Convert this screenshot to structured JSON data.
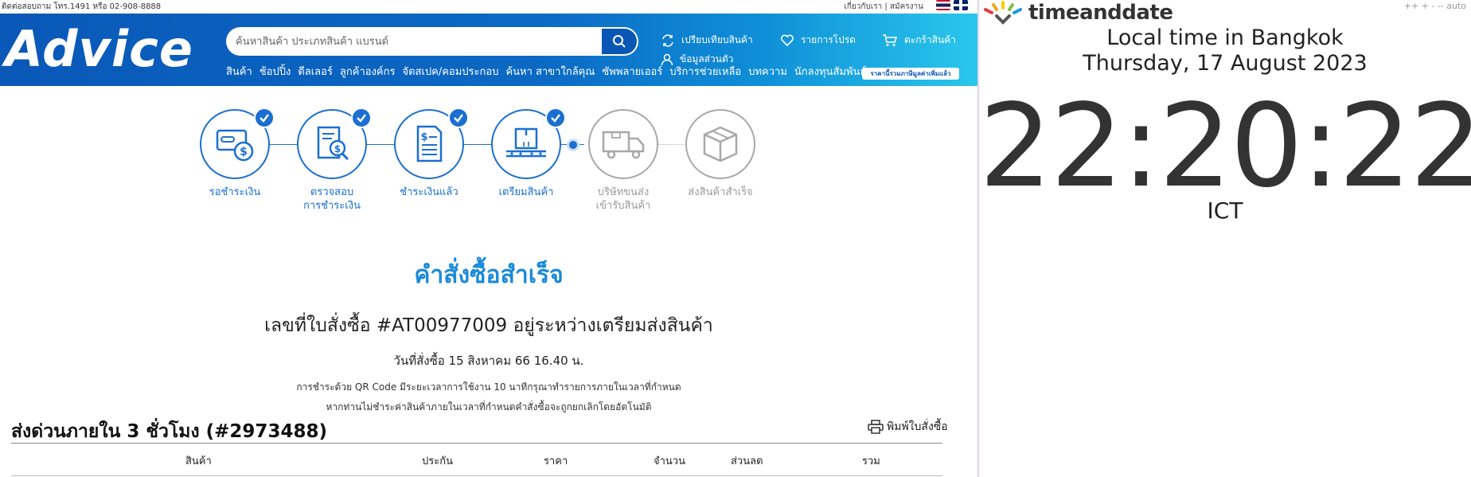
{
  "topbar": {
    "contact": "ติดต่อสอบถาม โทร.1491 หรือ 02-908-8888",
    "links": "เกี่ยวกับเรา | สมัครงาน"
  },
  "header": {
    "logo": "Advice",
    "search_placeholder": "ค้นหาสินค้า ประเภทสินค้า แบรนด์",
    "compare": "เปรียบเทียบสินค้า",
    "wishlist": "รายการโปรด",
    "cart": "ตะกร้าสินค้า",
    "profile": "ข้อมูลส่วนตัว",
    "menu": [
      "สินค้า",
      "ช้อปปิ้ง",
      "ดีลเลอร์",
      "ลูกค้าองค์กร",
      "จัดสเปค/คอมประกอบ",
      "ค้นหา สาขาใกล้คุณ",
      "ซัพพลายเออร์",
      "บริการช่วยเหลือ",
      "บทความ",
      "นักลงทุนสัมพันธ์"
    ],
    "price_badge": "ราคานี้รวมภาษีมูลค่าเพิ่มแล้ว"
  },
  "steps": [
    {
      "label1": "รอชำระเงิน",
      "label2": "",
      "done": true
    },
    {
      "label1": "ตรวจสอบ",
      "label2": "การชำระเงิน",
      "done": true
    },
    {
      "label1": "ชำระเงินแล้ว",
      "label2": "",
      "done": true
    },
    {
      "label1": "เตรียมสินค้า",
      "label2": "",
      "done": true
    },
    {
      "label1": "บริษัทขนส่ง",
      "label2": "เข้ารับสินค้า",
      "done": false
    },
    {
      "label1": "ส่งสินค้าสำเร็จ",
      "label2": "",
      "done": false
    }
  ],
  "order": {
    "success_title": "คำสั่งซื้อสำเร็จ",
    "order_line": "เลขที่ใบสั่งซื้อ #AT00977009 อยู่ระหว่างเตรียมส่งสินค้า",
    "order_date": "วันที่สั่งซื้อ 15 สิงหาคม 66 16.40 น.",
    "note1": "การชำระด้วย QR Code มีระยะเวลาการใช้งาน 10 นาทีกรุณาทำรายการภายในเวลาที่กำหนด",
    "note2": "หากท่านไม่ชำระค่าสินค้าภายในเวลาที่กำหนดคำสั่งซื้อจะถูกยกเลิกโดยอัตโนมัติ",
    "ship_title": "ส่งด่วนภายใน 3 ชั่วโมง (#2973488)",
    "print": "พิมพ์ใบสั่งซื้อ"
  },
  "table": {
    "columns": [
      "สินค้า",
      "ประกัน",
      "ราคา",
      "จำนวน",
      "ส่วนลด",
      "รวม"
    ]
  },
  "tad": {
    "logo": "timeanddate",
    "controls": "++  +  -  --   auto",
    "title": "Local time in Bangkok",
    "date": "Thursday, 17 August 2023",
    "time": "22:20:22",
    "abbr": "ICT"
  },
  "colors": {
    "brand_blue": "#0a58b8",
    "step_blue": "#1a6fd1",
    "success_blue": "#1a8ad8",
    "inactive_gray": "#9a9a9a"
  }
}
